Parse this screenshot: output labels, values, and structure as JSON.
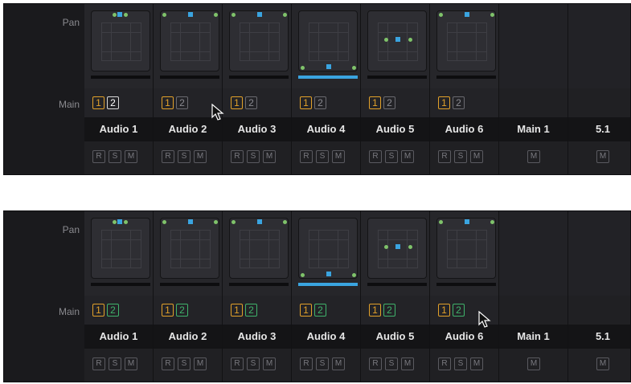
{
  "row_labels": {
    "pan": "Pan",
    "main": "Main"
  },
  "tracks": [
    {
      "name": "Audio 1",
      "r": "R",
      "s": "S",
      "m": "M",
      "bus1": "1",
      "bus2": "2"
    },
    {
      "name": "Audio 2",
      "r": "R",
      "s": "S",
      "m": "M",
      "bus1": "1",
      "bus2": "2"
    },
    {
      "name": "Audio 3",
      "r": "R",
      "s": "S",
      "m": "M",
      "bus1": "1",
      "bus2": "2"
    },
    {
      "name": "Audio 4",
      "r": "R",
      "s": "S",
      "m": "M",
      "bus1": "1",
      "bus2": "2"
    },
    {
      "name": "Audio 5",
      "r": "R",
      "s": "S",
      "m": "M",
      "bus1": "1",
      "bus2": "2"
    },
    {
      "name": "Audio 6",
      "r": "R",
      "s": "S",
      "m": "M",
      "bus1": "1",
      "bus2": "2"
    }
  ],
  "busses": [
    {
      "name": "Main 1",
      "m": "M"
    },
    {
      "name": "5.1",
      "m": "M"
    }
  ],
  "panels": [
    {
      "state": "before",
      "bus2_assigned": [
        false,
        false,
        false,
        false,
        false,
        false
      ],
      "cursor_on_track": "Audio 1"
    },
    {
      "state": "after",
      "bus2_assigned": [
        true,
        true,
        true,
        true,
        true,
        true
      ],
      "cursor_on_track": "Audio 6"
    }
  ],
  "colors": {
    "bus1": "#e2a12a",
    "bus2_on": "#3fb36b",
    "pan_point": "#3aa4e0",
    "pan_dots": "#7fc36a",
    "background": "#1d1d20"
  },
  "icons": [
    "pointer-cursor-icon"
  ]
}
